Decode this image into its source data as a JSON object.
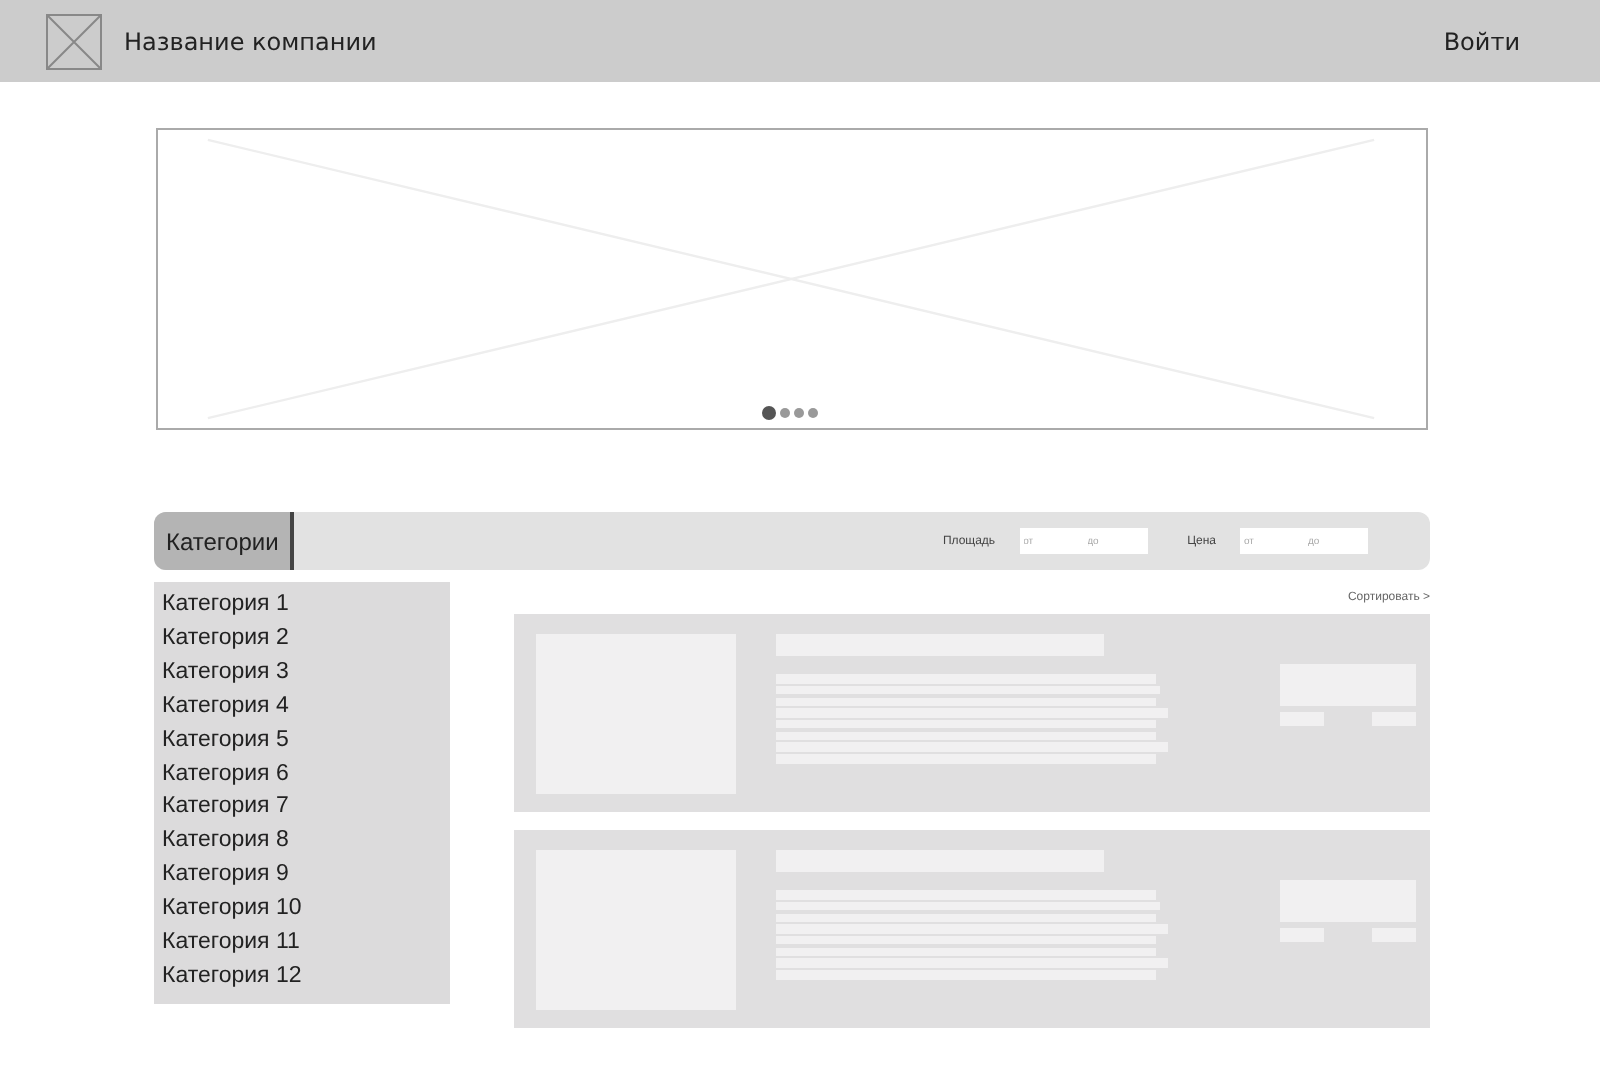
{
  "header": {
    "company": "Название компании",
    "login": "Войти"
  },
  "banner": {
    "kind": "picture",
    "dots": [
      {
        "selected": true
      },
      {
        "selected": false
      },
      {
        "selected": false
      },
      {
        "selected": false
      }
    ]
  },
  "filter_bar": {
    "tab": "Категории",
    "filters": [
      {
        "label": "Площадь",
        "from": {
          "placeholder": "от"
        },
        "to": {
          "placeholder": "до"
        }
      },
      {
        "label": "Цена",
        "from": {
          "placeholder": "от"
        },
        "to": {
          "placeholder": "до"
        }
      }
    ]
  },
  "sidebar": {
    "items": [
      "Категория 1",
      "Категория 2",
      "Категория 3",
      "Категория 4",
      "Категория 5",
      "Категория 6",
      "Категория 7",
      "Категория 8",
      "Категория 9",
      "Категория 10",
      "Категория 11",
      "Категория 12"
    ]
  },
  "sort_link": "Сортировать >",
  "products": [
    {
      "kind": "placeholder"
    },
    {
      "kind": "placeholder"
    }
  ]
}
